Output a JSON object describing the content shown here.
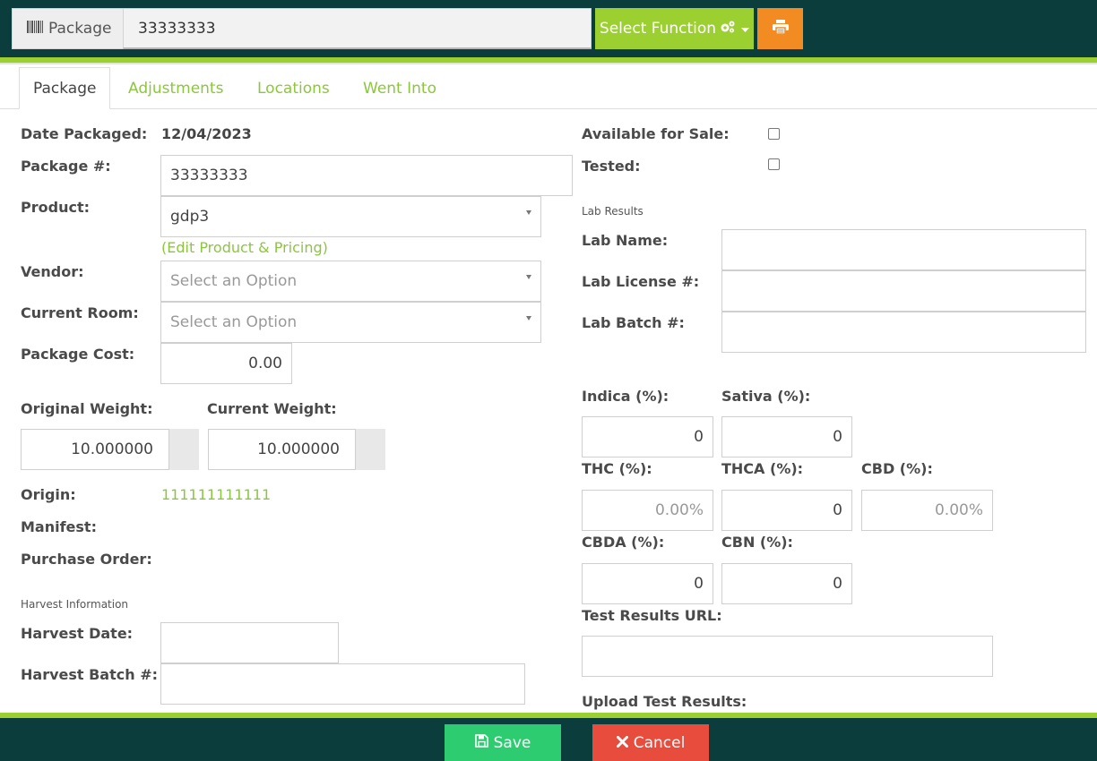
{
  "topbar": {
    "package_label": "Package",
    "package_value": "33333333",
    "select_function_label": "Select Function"
  },
  "tabs": [
    {
      "label": "Package",
      "active": true
    },
    {
      "label": "Adjustments",
      "active": false
    },
    {
      "label": "Locations",
      "active": false
    },
    {
      "label": "Went Into",
      "active": false
    }
  ],
  "left": {
    "date_packaged_label": "Date Packaged:",
    "date_packaged_value": "12/04/2023",
    "package_num_label": "Package #:",
    "package_num_value": "33333333",
    "product_label": "Product:",
    "product_value": "gdp3",
    "edit_product_link": "(Edit Product & Pricing)",
    "vendor_label": "Vendor:",
    "vendor_placeholder": "Select an Option",
    "current_room_label": "Current Room:",
    "current_room_placeholder": "Select an Option",
    "package_cost_label": "Package Cost:",
    "package_cost_value": "0.00",
    "original_weight_label": "Original Weight:",
    "original_weight_value": "10.000000",
    "current_weight_label": "Current Weight:",
    "current_weight_value": "10.000000",
    "origin_label": "Origin:",
    "origin_value": "111111111111",
    "manifest_label": "Manifest:",
    "purchase_order_label": "Purchase Order:",
    "harvest_info_header": "Harvest Information",
    "harvest_date_label": "Harvest Date:",
    "harvest_date_value": "",
    "harvest_batch_label": "Harvest Batch #:",
    "harvest_batch_value": ""
  },
  "right": {
    "available_label": "Available for Sale:",
    "available_checked": false,
    "tested_label": "Tested:",
    "tested_checked": false,
    "lab_results_header": "Lab Results",
    "lab_name_label": "Lab Name:",
    "lab_name_value": "",
    "lab_license_label": "Lab License #:",
    "lab_license_value": "",
    "lab_batch_label": "Lab Batch #:",
    "lab_batch_value": "",
    "indica_label": "Indica (%):",
    "indica_value": "0",
    "sativa_label": "Sativa (%):",
    "sativa_value": "0",
    "thc_label": "THC (%):",
    "thc_placeholder": "0.00%",
    "thca_label": "THCA (%):",
    "thca_value": "0",
    "cbd_label": "CBD (%):",
    "cbd_placeholder": "0.00%",
    "cbda_label": "CBDA (%):",
    "cbda_value": "0",
    "cbn_label": "CBN (%):",
    "cbn_value": "0",
    "test_url_label": "Test Results URL:",
    "test_url_value": "",
    "upload_label": "Upload Test Results:"
  },
  "footer": {
    "save_label": "Save",
    "cancel_label": "Cancel"
  },
  "colors": {
    "header_bg": "#0b3d3c",
    "accent_green": "#9bd030",
    "link_green": "#8cc63e",
    "print_orange": "#f18b22",
    "save_green": "#2ecc71",
    "cancel_red": "#e74c3c"
  }
}
